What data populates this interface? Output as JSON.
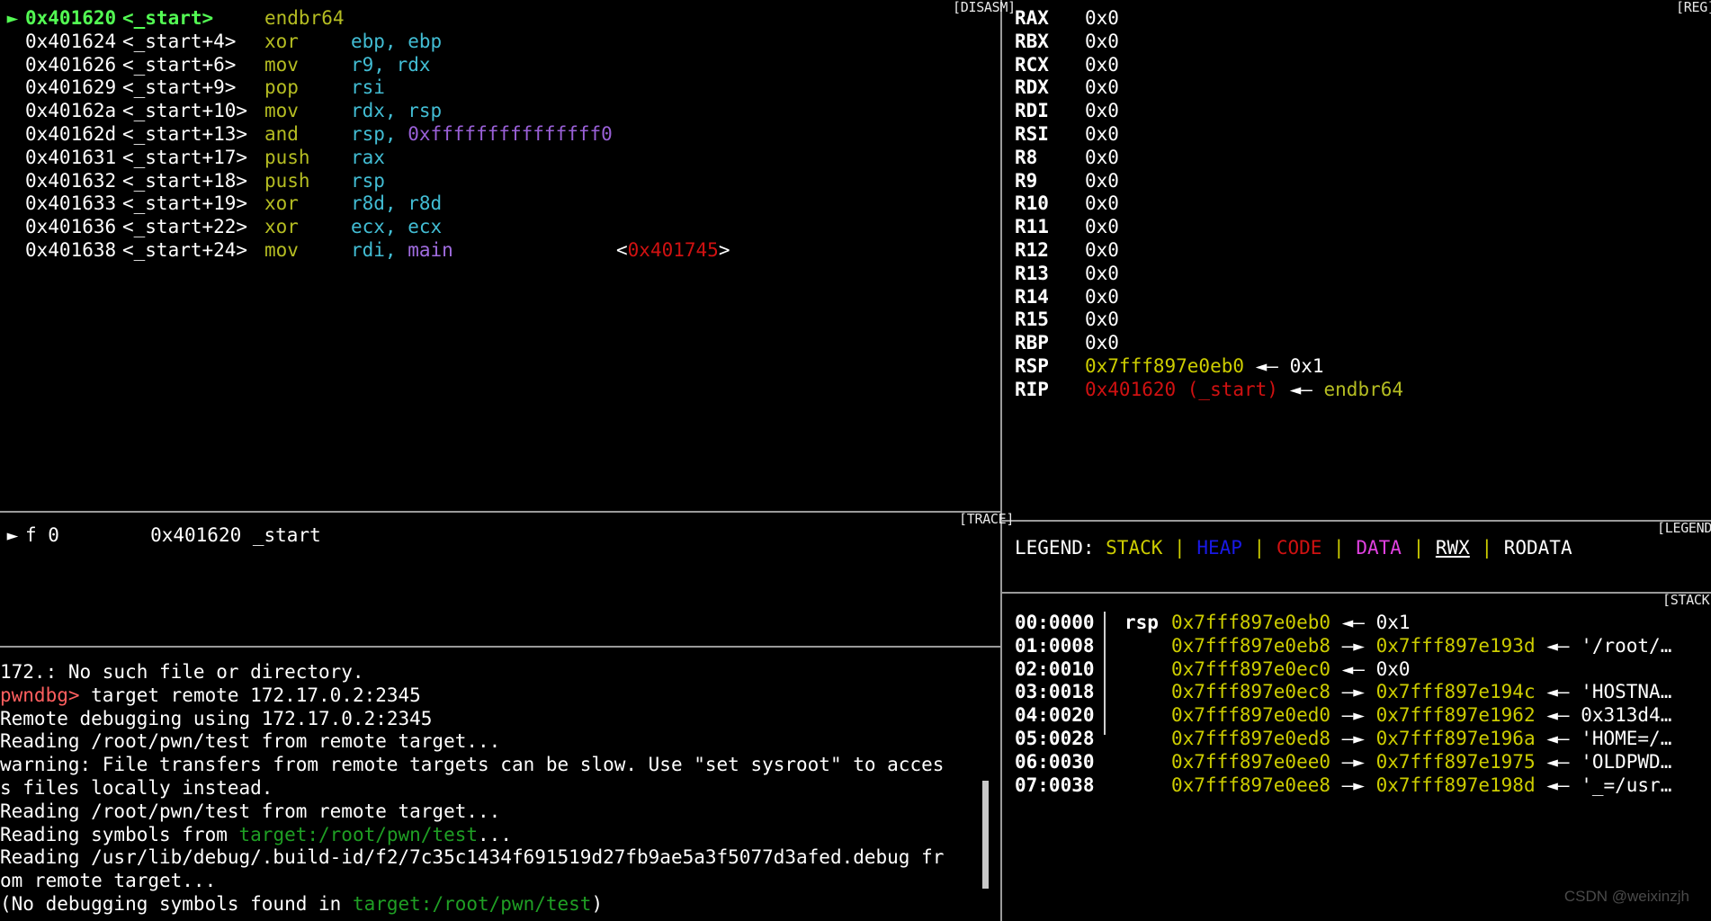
{
  "app": {
    "name": "pwndbg",
    "watermark": "CSDN @weixinzjh"
  },
  "colors": {
    "stack": "#cdcd00",
    "heap": "#1919e6",
    "code": "#d01111",
    "data": "#e040e0",
    "rodata": "#ffffff",
    "prompt": "#ff5f5f",
    "symbol_green": "#53fb53",
    "mnemonic": "#b5bd22",
    "register_operand": "#42bdd4",
    "immediate": "#9a60d8",
    "path": "#1f9f24",
    "background": "#000000",
    "divider": "#9a9a9a"
  },
  "panels": {
    "disasm_label": "[DISASM]",
    "regs_label": "[REG]",
    "trace_label": "[TRACE]",
    "legend_label": "[LEGEND]",
    "stack_label": "[STACK]"
  },
  "disasm": {
    "rows": [
      {
        "marker": "►",
        "addr": "0x401620",
        "sym": "<_start>",
        "mnemonic": "endbr64",
        "ops": "",
        "note": "",
        "current": true
      },
      {
        "marker": "",
        "addr": "0x401624",
        "sym": "<_start+4>",
        "mnemonic": "xor",
        "ops": "ebp, ebp",
        "note": ""
      },
      {
        "marker": "",
        "addr": "0x401626",
        "sym": "<_start+6>",
        "mnemonic": "mov",
        "ops": "r9, rdx",
        "note": ""
      },
      {
        "marker": "",
        "addr": "0x401629",
        "sym": "<_start+9>",
        "mnemonic": "pop",
        "ops": "rsi",
        "note": ""
      },
      {
        "marker": "",
        "addr": "0x40162a",
        "sym": "<_start+10>",
        "mnemonic": "mov",
        "ops": "rdx, rsp",
        "note": ""
      },
      {
        "marker": "",
        "addr": "0x40162d",
        "sym": "<_start+13>",
        "mnemonic": "and",
        "ops": "rsp, ",
        "imm": "0xfffffffffffffff0",
        "note": ""
      },
      {
        "marker": "",
        "addr": "0x401631",
        "sym": "<_start+17>",
        "mnemonic": "push",
        "ops": "rax",
        "note": ""
      },
      {
        "marker": "",
        "addr": "0x401632",
        "sym": "<_start+18>",
        "mnemonic": "push",
        "ops": "rsp",
        "note": ""
      },
      {
        "marker": "",
        "addr": "0x401633",
        "sym": "<_start+19>",
        "mnemonic": "xor",
        "ops": "r8d, r8d",
        "note": ""
      },
      {
        "marker": "",
        "addr": "0x401636",
        "sym": "<_start+22>",
        "mnemonic": "xor",
        "ops": "ecx, ecx",
        "note": ""
      },
      {
        "marker": "",
        "addr": "0x401638",
        "sym": "<_start+24>",
        "mnemonic": "mov",
        "ops": "rdi, ",
        "symbol_operand": "main",
        "note_addr": "0x401745"
      }
    ]
  },
  "registers": [
    {
      "name": "RAX",
      "value": "0x0",
      "value_color": "white"
    },
    {
      "name": "RBX",
      "value": "0x0",
      "value_color": "white"
    },
    {
      "name": "RCX",
      "value": "0x0",
      "value_color": "white"
    },
    {
      "name": "RDX",
      "value": "0x0",
      "value_color": "white"
    },
    {
      "name": "RDI",
      "value": "0x0",
      "value_color": "white"
    },
    {
      "name": "RSI",
      "value": "0x0",
      "value_color": "white"
    },
    {
      "name": "R8",
      "value": "0x0",
      "value_color": "white"
    },
    {
      "name": "R9",
      "value": "0x0",
      "value_color": "white"
    },
    {
      "name": "R10",
      "value": "0x0",
      "value_color": "white"
    },
    {
      "name": "R11",
      "value": "0x0",
      "value_color": "white"
    },
    {
      "name": "R12",
      "value": "0x0",
      "value_color": "white"
    },
    {
      "name": "R13",
      "value": "0x0",
      "value_color": "white"
    },
    {
      "name": "R14",
      "value": "0x0",
      "value_color": "white"
    },
    {
      "name": "R15",
      "value": "0x0",
      "value_color": "white"
    },
    {
      "name": "RBP",
      "value": "0x0",
      "value_color": "white"
    },
    {
      "name": "RSP",
      "value": "0x7fff897e0eb0",
      "value_color": "stack",
      "arrow": "◄—",
      "deref": "0x1",
      "deref_color": "white"
    },
    {
      "name": "RIP",
      "value": "0x401620 (_start)",
      "value_color": "code",
      "arrow": "◄—",
      "deref": "endbr64",
      "deref_color": "olive"
    }
  ],
  "legend": {
    "prefix": "LEGEND: ",
    "items": [
      {
        "label": "STACK",
        "color": "stack"
      },
      {
        "label": "HEAP",
        "color": "heap"
      },
      {
        "label": "CODE",
        "color": "code"
      },
      {
        "label": "DATA",
        "color": "data"
      },
      {
        "label": "RWX",
        "color": "rodata",
        "underline": true
      },
      {
        "label": "RODATA",
        "color": "rodata"
      }
    ],
    "separator": " | "
  },
  "trace": {
    "rows": [
      {
        "marker": "►",
        "frame": "f 0",
        "addr": "0x401620",
        "sym": "_start"
      }
    ]
  },
  "stack": {
    "rows": [
      {
        "offset": "00:0000",
        "reg": "rsp",
        "addr": "0x7fff897e0eb0",
        "arrow1": "◄—",
        "target": "0x1",
        "target_color": "white",
        "arrow2": "",
        "value": ""
      },
      {
        "offset": "01:0008",
        "reg": "",
        "addr": "0x7fff897e0eb8",
        "arrow1": "—►",
        "target": "0x7fff897e193d",
        "target_color": "stack",
        "arrow2": "◄—",
        "value": "'/root/…"
      },
      {
        "offset": "02:0010",
        "reg": "",
        "addr": "0x7fff897e0ec0",
        "arrow1": "◄—",
        "target": "0x0",
        "target_color": "white",
        "arrow2": "",
        "value": ""
      },
      {
        "offset": "03:0018",
        "reg": "",
        "addr": "0x7fff897e0ec8",
        "arrow1": "—►",
        "target": "0x7fff897e194c",
        "target_color": "stack",
        "arrow2": "◄—",
        "value": "'HOSTNA…"
      },
      {
        "offset": "04:0020",
        "reg": "",
        "addr": "0x7fff897e0ed0",
        "arrow1": "—►",
        "target": "0x7fff897e1962",
        "target_color": "stack",
        "arrow2": "◄—",
        "value": "0x313d4…"
      },
      {
        "offset": "05:0028",
        "reg": "",
        "addr": "0x7fff897e0ed8",
        "arrow1": "—►",
        "target": "0x7fff897e196a",
        "target_color": "stack",
        "arrow2": "◄—",
        "value": "'HOME=/…"
      },
      {
        "offset": "06:0030",
        "reg": "",
        "addr": "0x7fff897e0ee0",
        "arrow1": "—►",
        "target": "0x7fff897e1975",
        "target_color": "stack",
        "arrow2": "◄—",
        "value": "'OLDPWD…"
      },
      {
        "offset": "07:0038",
        "reg": "",
        "addr": "0x7fff897e0ee8",
        "arrow1": "—►",
        "target": "0x7fff897e198d",
        "target_color": "stack",
        "arrow2": "◄—",
        "value": "'_=/usr…"
      }
    ]
  },
  "console": {
    "lines": [
      {
        "segments": [
          {
            "text": "172.: No such file or directory.",
            "color": "white"
          }
        ]
      },
      {
        "segments": [
          {
            "text": "pwndbg>",
            "color": "prompt"
          },
          {
            "text": " target remote 172.17.0.2:2345",
            "color": "white"
          }
        ]
      },
      {
        "segments": [
          {
            "text": "Remote debugging using 172.17.0.2:2345",
            "color": "white"
          }
        ]
      },
      {
        "segments": [
          {
            "text": "Reading /root/pwn/test from remote target...",
            "color": "white"
          }
        ]
      },
      {
        "segments": [
          {
            "text": "warning: File transfers from remote targets can be slow. Use \"set sysroot\" to acces",
            "color": "white"
          }
        ]
      },
      {
        "segments": [
          {
            "text": "s files locally instead.",
            "color": "white"
          }
        ]
      },
      {
        "segments": [
          {
            "text": "Reading /root/pwn/test from remote target...",
            "color": "white"
          }
        ]
      },
      {
        "segments": [
          {
            "text": "Reading symbols from ",
            "color": "white"
          },
          {
            "text": "target:/root/pwn/test",
            "color": "path"
          },
          {
            "text": "...",
            "color": "white"
          }
        ]
      },
      {
        "segments": [
          {
            "text": "Reading /usr/lib/debug/.build-id/f2/7c35c1434f691519d27fb9ae5a3f5077d3afed.debug fr",
            "color": "white"
          }
        ]
      },
      {
        "segments": [
          {
            "text": "om remote target...",
            "color": "white"
          }
        ]
      },
      {
        "segments": [
          {
            "text": "(No debugging symbols found in ",
            "color": "white"
          },
          {
            "text": "target:/root/pwn/test",
            "color": "path"
          },
          {
            "text": ")",
            "color": "white"
          }
        ]
      }
    ]
  }
}
